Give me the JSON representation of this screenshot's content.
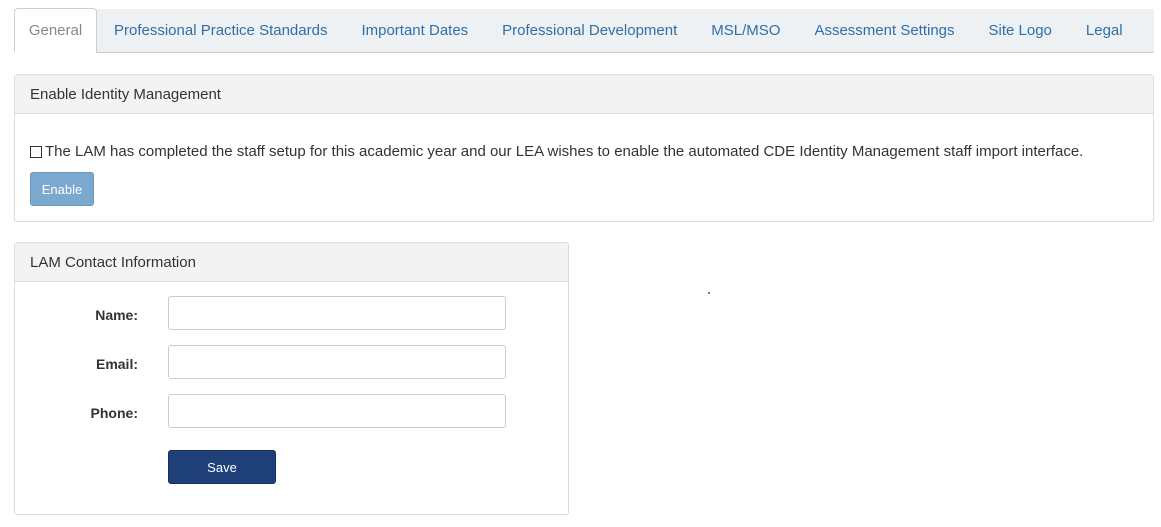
{
  "tabs": [
    {
      "label": "General",
      "active": true
    },
    {
      "label": "Professional Practice Standards",
      "active": false
    },
    {
      "label": "Important Dates",
      "active": false
    },
    {
      "label": "Professional Development",
      "active": false
    },
    {
      "label": "MSL/MSO",
      "active": false
    },
    {
      "label": "Assessment Settings",
      "active": false
    },
    {
      "label": "Site Logo",
      "active": false
    },
    {
      "label": "Legal",
      "active": false
    }
  ],
  "identity_panel": {
    "title": "Enable Identity Management",
    "checkbox_checked": false,
    "consent_text": "The LAM has completed the staff setup for this academic year and our LEA wishes to enable the automated CDE Identity Management staff import interface.",
    "enable_label": "Enable"
  },
  "contact_panel": {
    "title": "LAM Contact Information",
    "name_label": "Name:",
    "name_value": "",
    "email_label": "Email:",
    "email_value": "",
    "phone_label": "Phone:",
    "phone_value": "",
    "save_label": "Save"
  },
  "colors": {
    "tab_link": "#2f6fa7",
    "enable_button": "#7aa8cf",
    "save_button": "#1f3f78"
  }
}
